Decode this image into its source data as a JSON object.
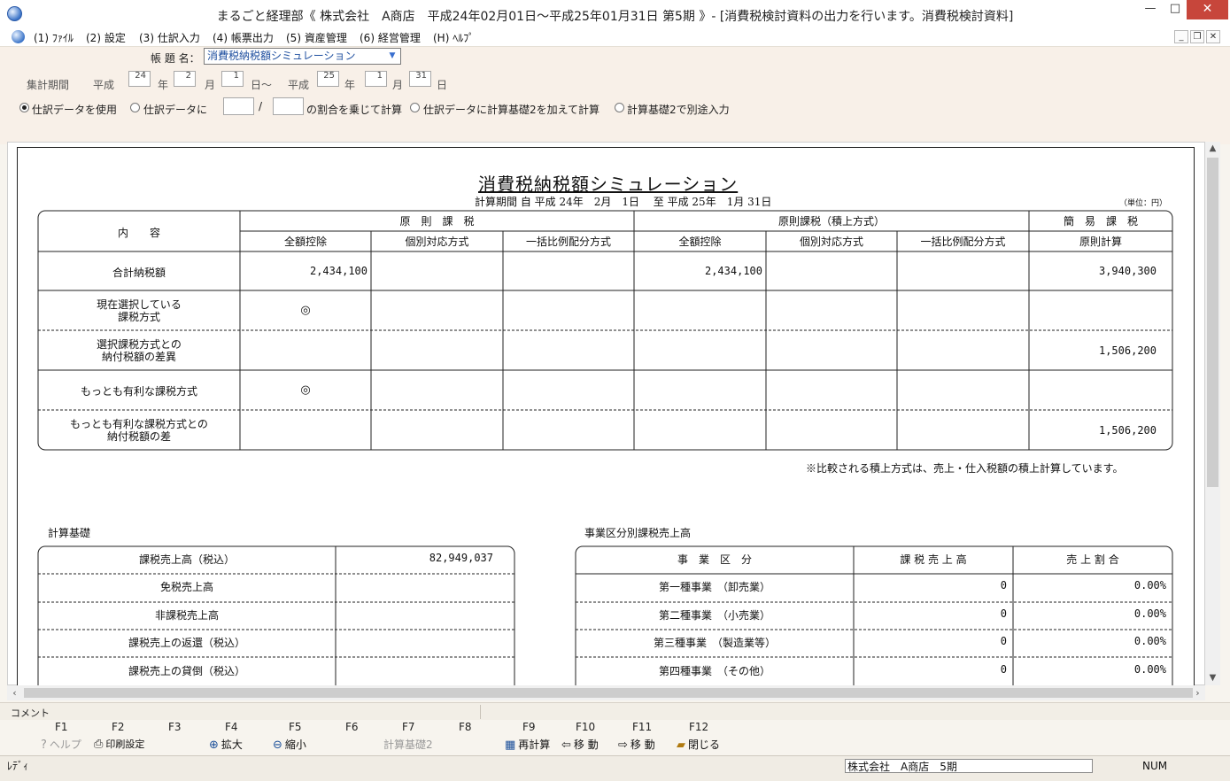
{
  "window": {
    "title": "まるごと経理部《 株式会社　A商店　平成24年02月01日～平成25年01月31日 第5期 》- [消費税検討資料の出力を行います。消費税検討資料]",
    "min": "—",
    "max": "□",
    "close": "✕"
  },
  "menu": [
    "(1) ﾌｧｲﾙ",
    "(2) 設定",
    "(3) 仕訳入力",
    "(4) 帳票出力",
    "(5) 資産管理",
    "(6) 経営管理",
    "(H) ﾍﾙﾌﾟ"
  ],
  "form": {
    "report_label": "帳 題 名：",
    "report_value": "消費税納税額シミュレーション",
    "period_label": "集計期間",
    "era1": "平成",
    "y1": "24",
    "y_unit": "年",
    "m1": "2",
    "m_unit": "月",
    "d1": "1",
    "d_unit": "日～",
    "era2": "平成",
    "y2": "25",
    "m2": "1",
    "d2": "31",
    "d_unit2": "日",
    "r1": "仕訳データを使用",
    "r2": "仕訳データに",
    "slash": "/",
    "r2b": "の割合を乗じて計算",
    "r3": "仕訳データに計算基礎2を加えて計算",
    "r4": "計算基礎2で別途入力"
  },
  "report": {
    "title": "消費税納税額シミュレーション",
    "period": "計算期間 自 平成 24年　2月　1日　 至 平成 25年　1月 31日",
    "unit": "（単位：円）",
    "h_naiyou": "内　　容",
    "h_gensoku": "原　則　課　税",
    "h_tsumiage": "原則課税（積上方式）",
    "h_kani": "簡　易　課　税",
    "sub": [
      "全額控除",
      "個別対応方式",
      "一括比例配分方式",
      "全額控除",
      "個別対応方式",
      "一括比例配分方式",
      "原則計算"
    ],
    "rows": [
      {
        "label": "合計納税額",
        "c1": "2,434,100",
        "c4": "2,434,100",
        "c7": "3,940,300"
      },
      {
        "label1": "現在選択している",
        "label2": "課税方式",
        "c1": "◎"
      },
      {
        "label1": "選択課税方式との",
        "label2": "納付税額の差異",
        "c7": "1,506,200"
      },
      {
        "label": "もっとも有利な課税方式",
        "c1": "◎"
      },
      {
        "label1": "もっとも有利な課税方式との",
        "label2": "納付税額の差",
        "c7": "1,506,200"
      }
    ],
    "note": "※比較される積上方式は、売上・仕入税額の積上計算しています。",
    "basis_title": "計算基礎",
    "basis": [
      {
        "label": "課税売上高（税込）",
        "value": "82,949,037"
      },
      {
        "label": "免税売上高",
        "value": ""
      },
      {
        "label": "非課税売上高",
        "value": ""
      },
      {
        "label": "課税売上の返還（税込）",
        "value": ""
      },
      {
        "label": "課税売上の貸倒（税込）",
        "value": ""
      }
    ],
    "biz_title": "事業区分別課税売上高",
    "biz_head": [
      "事　業　区　分",
      "課 税 売 上 高",
      "売 上 割 合"
    ],
    "biz": [
      {
        "name": "第一種事業　（卸売業）",
        "amount": "0",
        "ratio": "0.00%"
      },
      {
        "name": "第二種事業　（小売業）",
        "amount": "0",
        "ratio": "0.00%"
      },
      {
        "name": "第三種事業　（製造業等）",
        "amount": "0",
        "ratio": "0.00%"
      },
      {
        "name": "第四種事業　（その他）",
        "amount": "0",
        "ratio": "0.00%"
      }
    ]
  },
  "comment_label": "コメント",
  "fkeys": [
    "F1",
    "F2",
    "F3",
    "F4",
    "F5",
    "F6",
    "F7",
    "F8",
    "F9",
    "F10",
    "F11",
    "F12"
  ],
  "fkey_labels": {
    "f1": "ヘルプ",
    "f2": "印刷設定",
    "f4": "拡大",
    "f5": "縮小",
    "f7": "計算基礎2",
    "f9": "再計算",
    "f10": "移 動",
    "f11": "移 動",
    "f12": "閉じる"
  },
  "status": {
    "ready": "ﾚﾃﾞｨ",
    "company": "株式会社　A商店　5期",
    "num": "NUM"
  },
  "colors": {
    "close_button": "#c7463b",
    "accent": "#3b74c8"
  }
}
